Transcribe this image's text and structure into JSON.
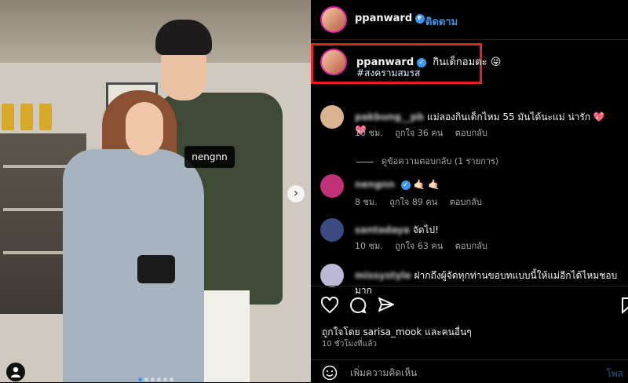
{
  "photo": {
    "tag_label": "nengnn",
    "next_icon": "chevron-right-icon",
    "carousel_dots": 6,
    "active_dot": 0
  },
  "header": {
    "username": "ppanward",
    "separator": "•",
    "follow_label": "ติดตาม"
  },
  "caption": {
    "username": "ppanward",
    "text": "กินเด็กอมตะ 😝",
    "hashtag": "#สงครามสมรส"
  },
  "comments": [
    {
      "username": "pakbung__pb",
      "text": "แม่ลองกินเด็กไหม 55 มันได้นะแม่ น่ารัก 💖 💖",
      "time": "10 ชม.",
      "likes": "ถูกใจ 36 คน",
      "reply": "ตอบกลับ",
      "avatar_color": "#d9b48f"
    },
    {
      "username": "nengnn",
      "text": "🤙🏻 🤙🏻",
      "time": "8 ชม.",
      "likes": "ถูกใจ 89 คน",
      "reply": "ตอบกลับ",
      "avatar_color": "#c0317a"
    },
    {
      "username": "santadaya",
      "text": "จัดไป!",
      "time": "10 ชม.",
      "likes": "ถูกใจ 63 คน",
      "reply": "ตอบกลับ",
      "avatar_color": "#3c4a82"
    },
    {
      "username": "missystyle",
      "text": "ฝากถึงผู้จัดทุกท่านขอบทแบบนี้ให้แม่อีกได้ไหมชอบมาก",
      "time": "",
      "likes": "",
      "reply": "",
      "avatar_color": "#b9b9d6"
    }
  ],
  "view_replies": "ดูข้อความตอบกลับ (1 รายการ)",
  "actions": {
    "like_icon": "heart-icon",
    "comment_icon": "comment-icon",
    "share_icon": "send-icon",
    "save_icon": "bookmark-icon",
    "liked_by": "ถูกใจโดย sarisa_mook และคนอื่นๆ",
    "time_ago": "10 ชั่วโมงที่แล้ว"
  },
  "comment_box": {
    "placeholder": "เพิ่มความคิดเห็น",
    "post_label": "โพส",
    "emoji_icon": "emoji-icon"
  },
  "colors": {
    "accent": "#3897f0",
    "highlight_box": "#e02424",
    "background": "#000000"
  }
}
